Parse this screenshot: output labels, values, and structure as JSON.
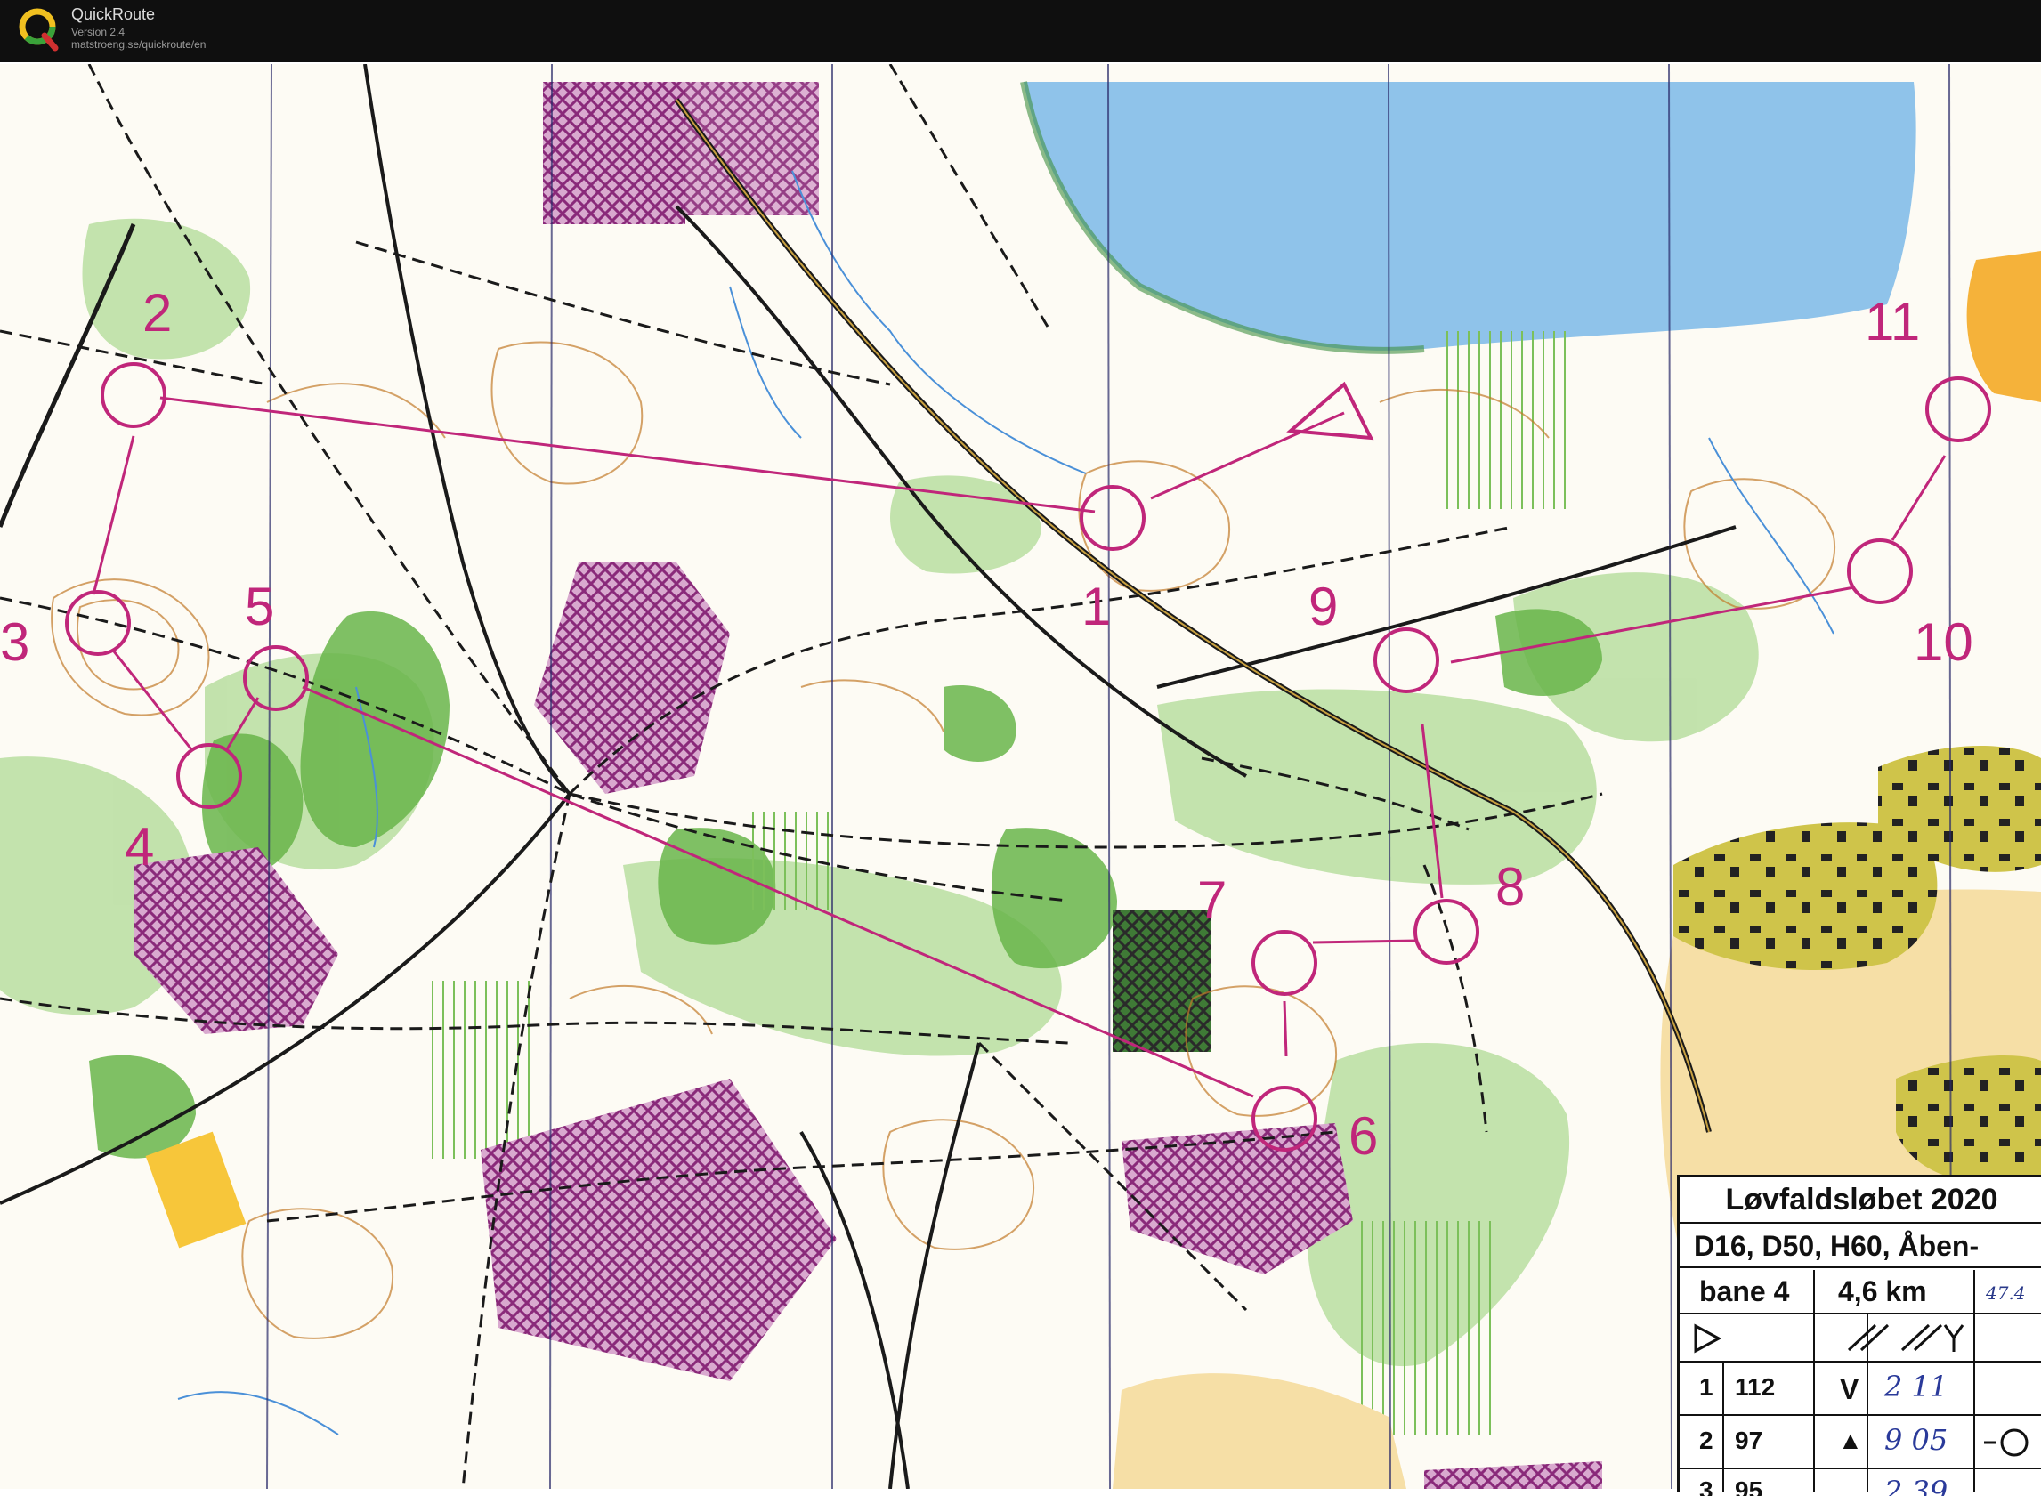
{
  "app": {
    "title": "QuickRoute",
    "version": "Version 2.4",
    "url": "matstroeng.se/quickroute/en"
  },
  "colors": {
    "course": "#c0267a",
    "water": "#8fc3ea",
    "forest": "#69b54a",
    "forest_light": "#b8dea0",
    "contour": "#c27a2a",
    "field": "#f7c63a",
    "out_of_bounds": "#8a2a7a",
    "paper": "#fdfbf4"
  },
  "course": {
    "start_label": "",
    "controls": [
      {
        "label": "1"
      },
      {
        "label": "2"
      },
      {
        "label": "3"
      },
      {
        "label": "4"
      },
      {
        "label": "5"
      },
      {
        "label": "6"
      },
      {
        "label": "7"
      },
      {
        "label": "8"
      },
      {
        "label": "9"
      },
      {
        "label": "10"
      },
      {
        "label": "11"
      }
    ]
  },
  "legend": {
    "title": "Løvfaldsløbet 2020",
    "classes": "D16, D50, H60, Åben-",
    "course_name": "bane 4",
    "length": "4,6 km",
    "handwritten_total": "47.4",
    "rows": [
      {
        "num": "1",
        "code": "112",
        "symbol": "V",
        "split": "2 11"
      },
      {
        "num": "2",
        "code": "97",
        "symbol": "▲",
        "split": "9 05"
      },
      {
        "num": "3",
        "code": "95",
        "symbol": "",
        "split": "2 39"
      }
    ]
  }
}
